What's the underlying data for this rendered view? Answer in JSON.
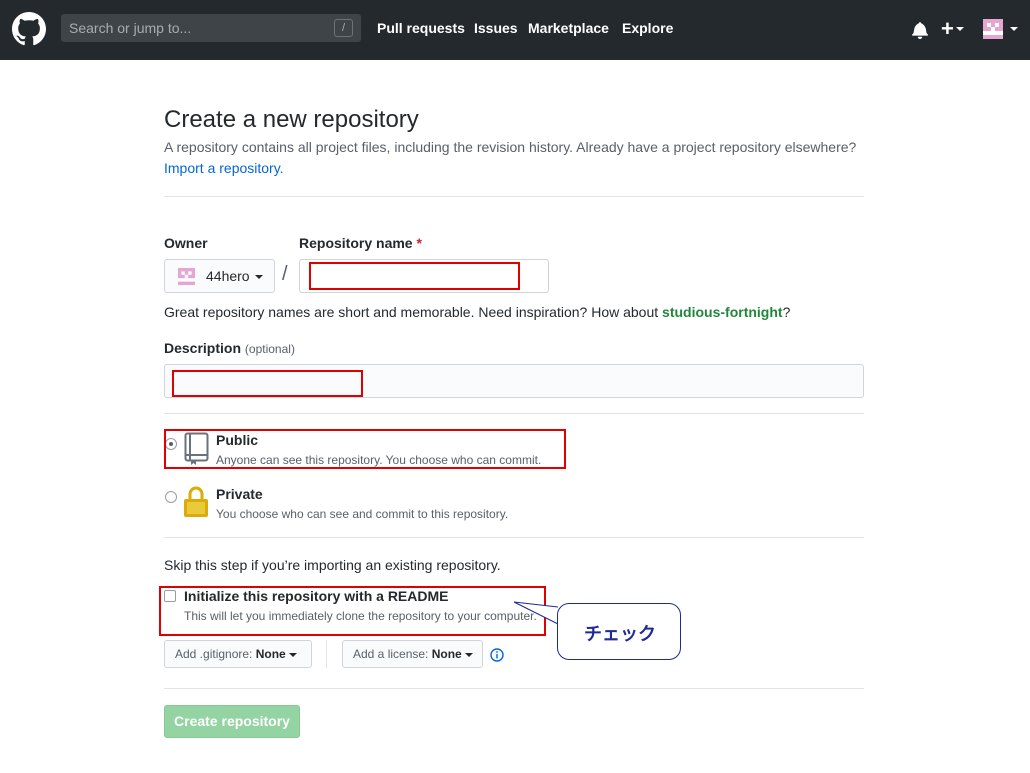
{
  "header": {
    "search_placeholder": "Search or jump to...",
    "search_key": "/",
    "nav": [
      "Pull requests",
      "Issues",
      "Marketplace",
      "Explore"
    ]
  },
  "page": {
    "title": "Create a new repository",
    "subtitle": "A repository contains all project files, including the revision history. Already have a project repository elsewhere?",
    "import_link": "Import a repository."
  },
  "form": {
    "owner_label": "Owner",
    "owner_name": "44hero",
    "repo_label": "Repository name",
    "required_mark": "*",
    "separator": "/",
    "hint_prefix": "Great repository names are short and memorable. Need inspiration? How about ",
    "hint_suggestion": "studious-fortnight",
    "hint_suffix": "?",
    "description_label": "Description",
    "description_optional": "(optional)",
    "visibility": {
      "public_title": "Public",
      "public_desc": "Anyone can see this repository. You choose who can commit.",
      "private_title": "Private",
      "private_desc": "You choose who can see and commit to this repository.",
      "selected": "public"
    },
    "skip_text": "Skip this step if you’re importing an existing repository.",
    "readme_title": "Initialize this repository with a README",
    "readme_desc": "This will let you immediately clone the repository to your computer.",
    "gitignore_label": "Add .gitignore:",
    "gitignore_value": "None",
    "license_label": "Add a license:",
    "license_value": "None",
    "create_button": "Create repository"
  },
  "annotation": {
    "callout_text": "チェック",
    "box_color": "#e00000",
    "callout_color": "#1e2a96"
  }
}
